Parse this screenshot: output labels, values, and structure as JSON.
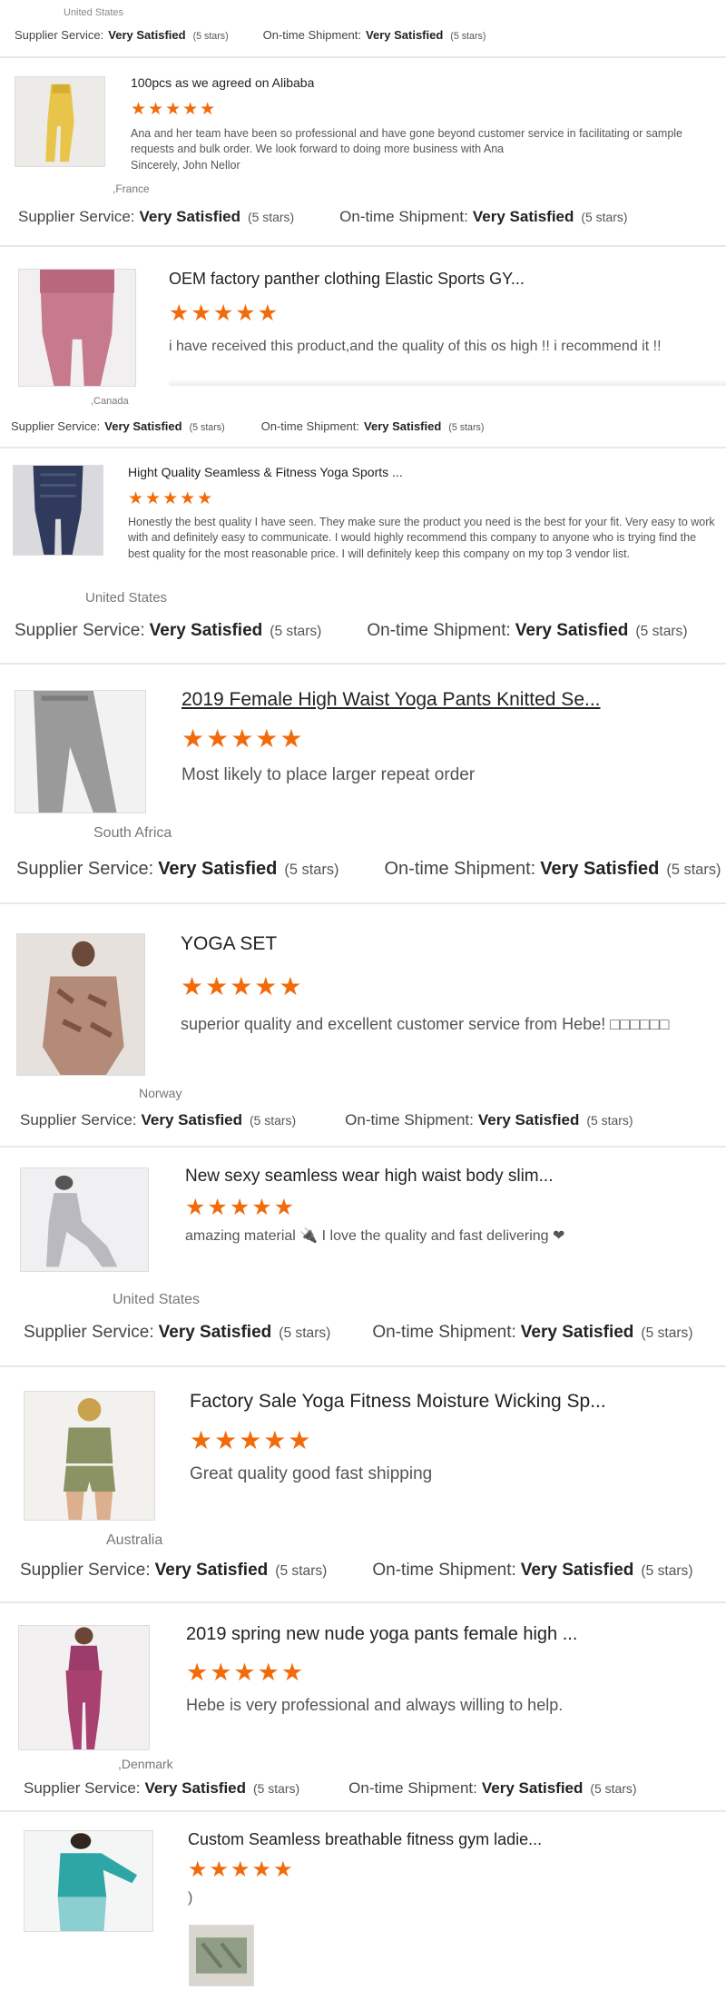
{
  "colors": {
    "star": "#f26b0b",
    "divider": "#e8e8e8",
    "text": "#555555"
  },
  "top": {
    "country": "United States"
  },
  "labels": {
    "supplier_service": "Supplier Service:",
    "ontime_shipment": "On-time Shipment:",
    "very_satisfied": "Very Satisfied",
    "five_stars": "(5 stars)",
    "star_glyphs": "★★★★★"
  },
  "reviews": [
    {
      "title": "100pcs as we agreed on Alibaba",
      "text": "Ana and her team have been so professional and have gone beyond customer service in facilitating or sample requests and bulk order. We look forward to doing more business with Ana\nSincerely, John Nellor",
      "country": ",France",
      "image": "yellow-leggings-photo",
      "rating": 5
    },
    {
      "title": "OEM factory panther clothing Elastic Sports GY...",
      "text": "i have received this product,and the quality of this os high !! i recommend it !!",
      "country": ",Canada",
      "image": "pink-leggings-photo",
      "rating": 5
    },
    {
      "title": "Hight Quality Seamless & Fitness Yoga Sports ...",
      "text": "Honestly the best quality I have seen. They make sure the product you need is the best for your fit. Very easy to work with and definitely easy to communicate. I would highly recommend this company to anyone who is trying find the best quality for the most reasonable price. I will definitely keep this company on my top 3 vendor list.",
      "country": "United States",
      "image": "navy-leggings-photo",
      "rating": 5
    },
    {
      "title": "2019 Female High Waist Yoga Pants Knitted Se...",
      "text": "Most likely to place larger repeat order",
      "country": "South Africa",
      "image": "grey-leggings-photo",
      "rating": 5
    },
    {
      "title": "YOGA SET",
      "text": "superior quality and excellent customer service from Hebe! □□□□□□",
      "country": "Norway",
      "image": "snake-print-top-photo",
      "rating": 5
    },
    {
      "title": "New sexy seamless wear high waist body slim...",
      "text": "amazing material 🔌 I love the quality and fast delivering ❤",
      "country": "United States",
      "image": "grey-set-photo",
      "rating": 5
    },
    {
      "title": "Factory Sale Yoga Fitness Moisture Wicking Sp...",
      "text": "Great quality good fast shipping",
      "country": "Australia",
      "image": "olive-set-photo",
      "rating": 5
    },
    {
      "title": "2019 spring new nude yoga pants female high ...",
      "text": "Hebe is very professional and always willing to help.",
      "country": ",Denmark",
      "image": "berry-leggings-photo",
      "rating": 5
    },
    {
      "title": "Custom Seamless breathable fitness gym ladie...",
      "text": ")",
      "country": "",
      "image": "teal-top-photo",
      "rating": 5,
      "attachment": "attachment-photo"
    }
  ]
}
